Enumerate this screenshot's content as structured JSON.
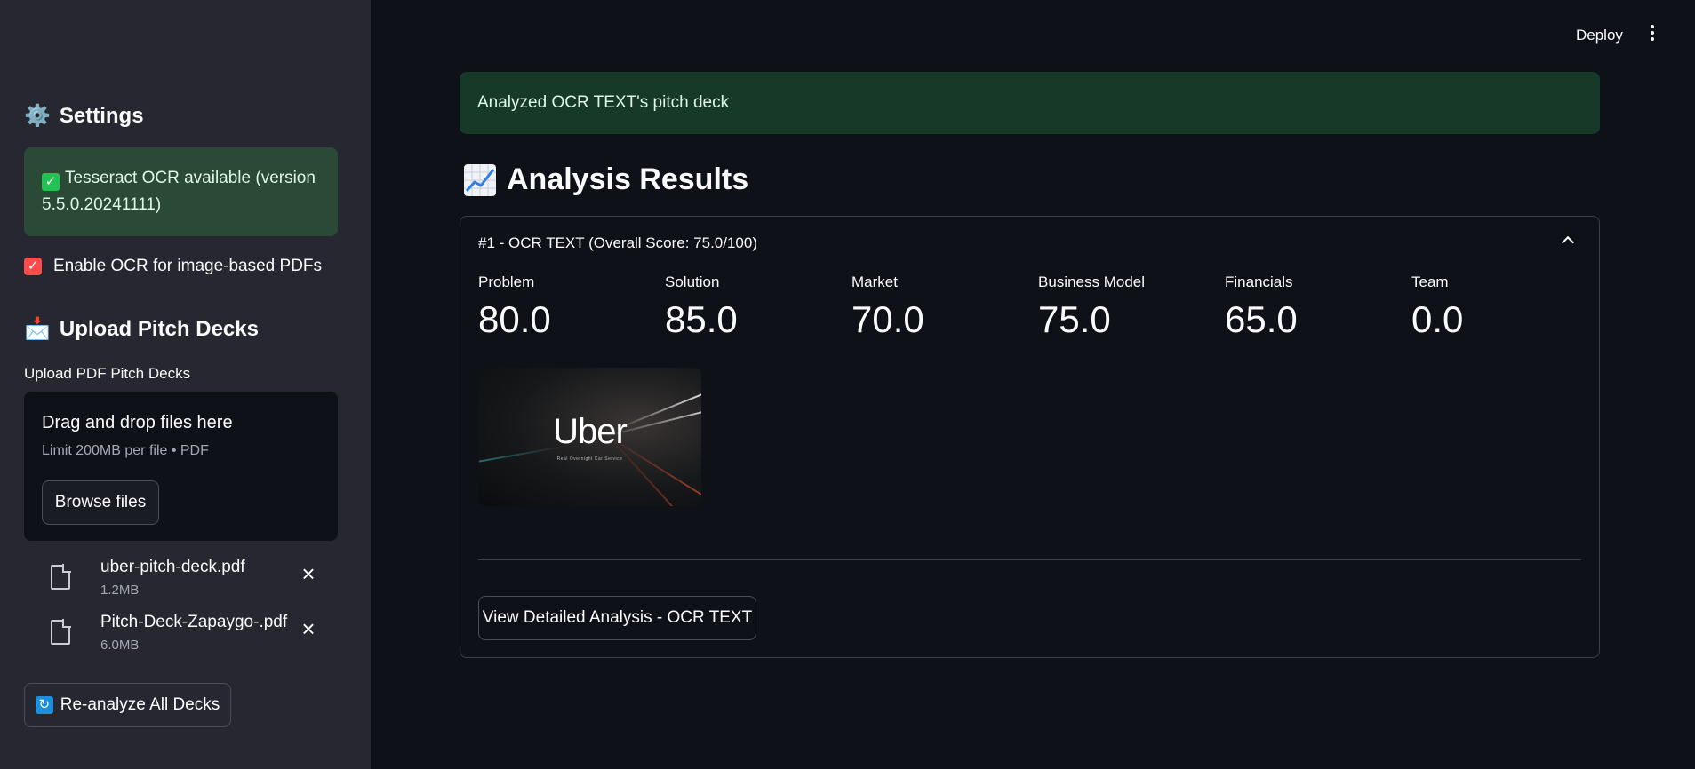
{
  "header": {
    "deploy_label": "Deploy",
    "menu_icon": "more-vert-icon"
  },
  "sidebar": {
    "settings_icon": "⚙️",
    "settings_title": "Settings",
    "ocr_status": "Tesseract OCR available (version 5.5.0.20241111)",
    "ocr_toggle_label": "Enable OCR for image-based PDFs",
    "ocr_toggle_checked": true,
    "upload_icon": "📩",
    "upload_title": "Upload Pitch Decks",
    "uploader": {
      "label": "Upload PDF Pitch Decks",
      "drop_text": "Drag and drop files here",
      "limit_text": "Limit 200MB per file • PDF",
      "browse_label": "Browse files"
    },
    "files": [
      {
        "name": "uber-pitch-deck.pdf",
        "size": "1.2MB"
      },
      {
        "name": "Pitch-Deck-Zapaygo-.pdf",
        "size": "6.0MB"
      }
    ],
    "reanalyze_label": "Re-analyze All Decks"
  },
  "main": {
    "success_message": "Analyzed OCR TEXT's pitch deck",
    "results_title": "Analysis Results",
    "expander": {
      "title": "#1 - OCR TEXT (Overall Score: 75.0/100)",
      "metrics": [
        {
          "label": "Problem",
          "value": "80.0"
        },
        {
          "label": "Solution",
          "value": "85.0"
        },
        {
          "label": "Market",
          "value": "70.0"
        },
        {
          "label": "Business Model",
          "value": "75.0"
        },
        {
          "label": "Financials",
          "value": "65.0"
        },
        {
          "label": "Team",
          "value": "0.0"
        }
      ],
      "thumbnail": {
        "logo_text": "Uber",
        "subtitle": "Real Overnight Car Service"
      },
      "detail_button_label": "View Detailed Analysis - OCR TEXT"
    }
  },
  "colors": {
    "sidebar_bg": "#262730",
    "main_bg": "#0e1117",
    "success_bg": "#173928",
    "checkbox_accent": "#ff4b4b"
  }
}
